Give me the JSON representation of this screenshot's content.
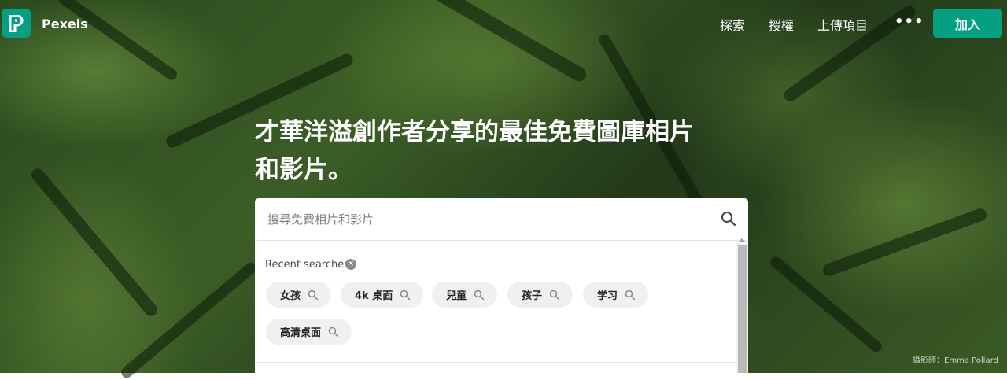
{
  "nav": {
    "brand": "Pexels",
    "links": [
      "探索",
      "授權",
      "上傳項目"
    ],
    "more": "•••",
    "join_label": "加入"
  },
  "hero": {
    "headline_line1": "才華洋溢創作者分享的最佳免費圖庫相片",
    "headline_line2": "和影片。"
  },
  "search": {
    "placeholder": "搜尋免費相片和影片",
    "recent_label": "Recent searches",
    "recent": [
      "女孩",
      "4k 桌面",
      "兒童",
      "孩子",
      "学习",
      "高清桌面"
    ]
  },
  "photo_credit": "攝影師：Emma Pollard",
  "colors": {
    "brand": "#05a081"
  }
}
